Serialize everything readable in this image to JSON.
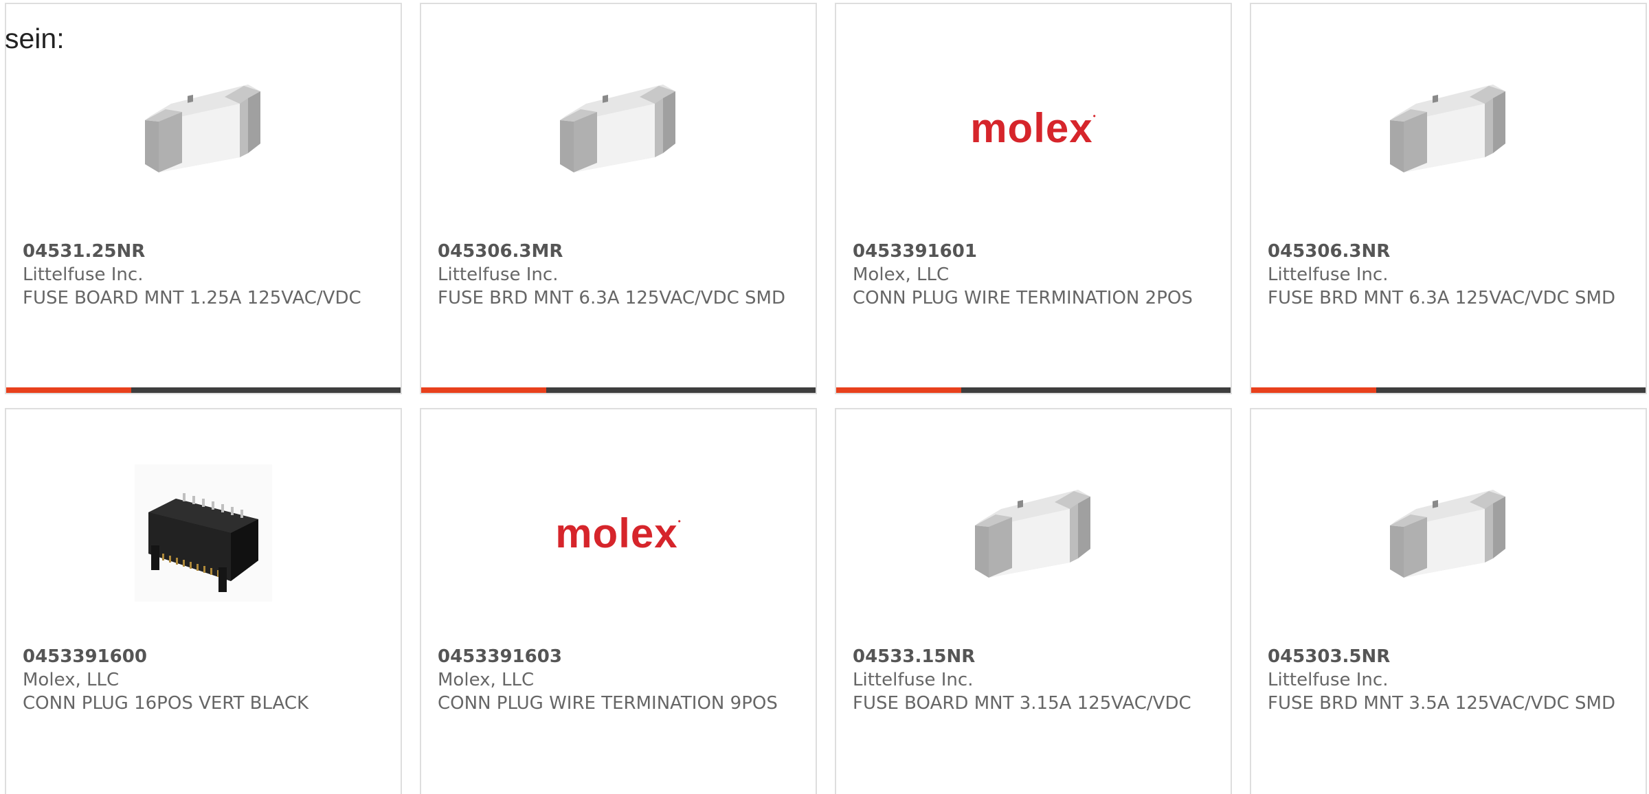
{
  "lead_text": "sein:",
  "colors": {
    "accent": "#e8401c",
    "bar": "#3e3e3e",
    "border": "#dedede",
    "text": "#666666",
    "molex_red": "#d6252b"
  },
  "products": [
    {
      "part_number": "04531.25NR",
      "manufacturer": "Littelfuse Inc.",
      "description": "FUSE BOARD MNT 1.25A 125VAC/VDC",
      "image": "fuse-image"
    },
    {
      "part_number": "045306.3MR",
      "manufacturer": "Littelfuse Inc.",
      "description": "FUSE BRD MNT 6.3A 125VAC/VDC SMD",
      "image": "fuse-image"
    },
    {
      "part_number": "0453391601",
      "manufacturer": "Molex, LLC",
      "description": "CONN PLUG WIRE TERMINATION 2POS",
      "image": "molex-logo",
      "logo_text": "molex"
    },
    {
      "part_number": "045306.3NR",
      "manufacturer": "Littelfuse Inc.",
      "description": "FUSE BRD MNT 6.3A 125VAC/VDC SMD",
      "image": "fuse-image"
    },
    {
      "part_number": "0453391600",
      "manufacturer": "Molex, LLC",
      "description": "CONN PLUG 16POS VERT BLACK",
      "image": "connector-image"
    },
    {
      "part_number": "0453391603",
      "manufacturer": "Molex, LLC",
      "description": "CONN PLUG WIRE TERMINATION 9POS",
      "image": "molex-logo",
      "logo_text": "molex"
    },
    {
      "part_number": "04533.15NR",
      "manufacturer": "Littelfuse Inc.",
      "description": "FUSE BOARD MNT 3.15A 125VAC/VDC",
      "image": "fuse-image"
    },
    {
      "part_number": "045303.5NR",
      "manufacturer": "Littelfuse Inc.",
      "description": "FUSE BRD MNT 3.5A 125VAC/VDC SMD",
      "image": "fuse-image"
    }
  ]
}
